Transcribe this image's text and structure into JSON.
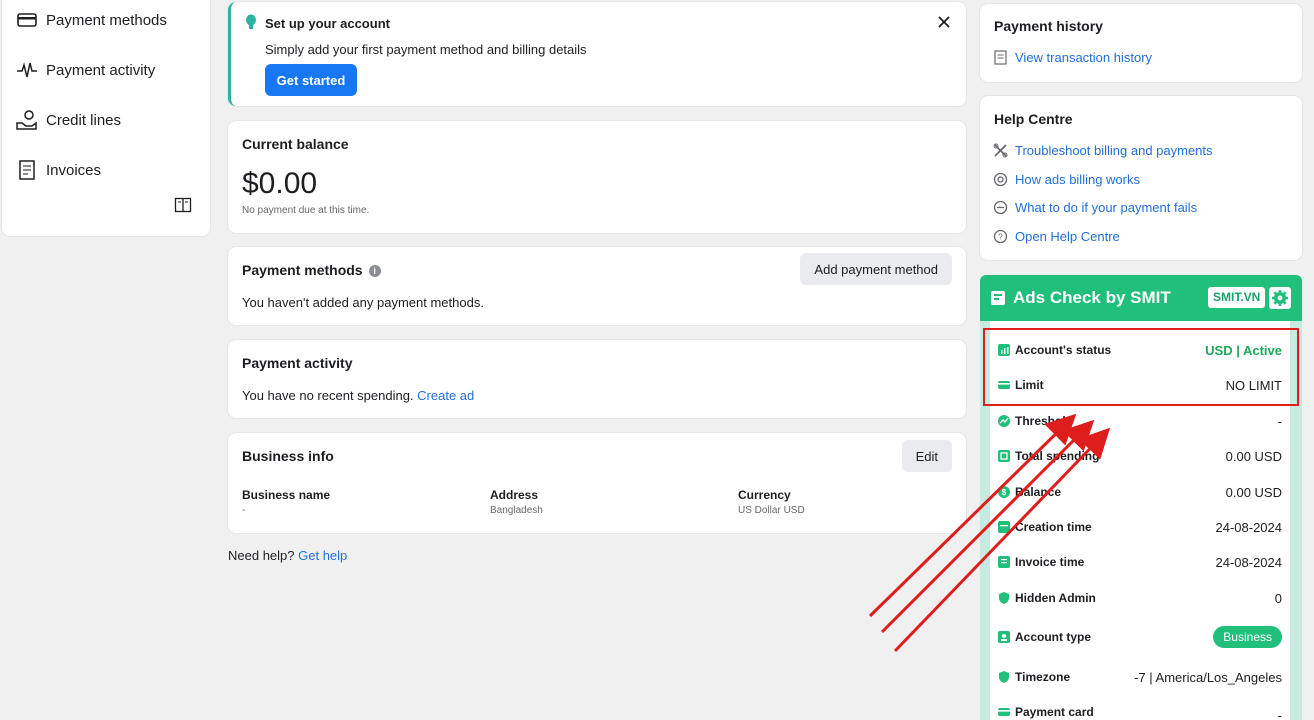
{
  "sidebar": {
    "items": [
      {
        "label": "Payment methods",
        "icon": "card-icon"
      },
      {
        "label": "Payment activity",
        "icon": "activity-icon"
      },
      {
        "label": "Credit lines",
        "icon": "hand-money-icon"
      },
      {
        "label": "Invoices",
        "icon": "invoice-icon"
      }
    ]
  },
  "setup": {
    "title": "Set up your account",
    "description": "Simply add your first payment method and billing details",
    "button": "Get started"
  },
  "balance": {
    "title": "Current balance",
    "amount": "$0.00",
    "note": "No payment due at this time."
  },
  "payment_methods": {
    "title": "Payment methods",
    "button": "Add payment method",
    "text": "You haven't added any payment methods."
  },
  "payment_activity": {
    "title": "Payment activity",
    "text": "You have no recent spending.",
    "link": "Create ad"
  },
  "business_info": {
    "title": "Business info",
    "button": "Edit",
    "columns": [
      {
        "header": "Business name",
        "value": "-"
      },
      {
        "header": "Address",
        "value": "Bangladesh"
      },
      {
        "header": "Currency",
        "value": "US Dollar USD"
      }
    ]
  },
  "need_help": {
    "text": "Need help?",
    "link": "Get help"
  },
  "payment_history": {
    "title": "Payment history",
    "link": "View transaction history"
  },
  "help_centre": {
    "title": "Help Centre",
    "links": [
      "Troubleshoot billing and payments",
      "How ads billing works",
      "What to do if your payment fails",
      "Open Help Centre"
    ]
  },
  "smit": {
    "title": "Ads Check by SMIT",
    "badge": "SMIT.VN",
    "rows": [
      {
        "label": "Account's status",
        "value": "USD | Active"
      },
      {
        "label": "Limit",
        "value": "NO LIMIT"
      },
      {
        "label": "Threshold",
        "value": "-"
      },
      {
        "label": "Total spending",
        "value": "0.00 USD"
      },
      {
        "label": "Balance",
        "value": "0.00 USD"
      },
      {
        "label": "Creation time",
        "value": "24-08-2024"
      },
      {
        "label": "Invoice time",
        "value": "24-08-2024"
      },
      {
        "label": "Hidden Admin",
        "value": "0"
      },
      {
        "label": "Account type",
        "value": "Business"
      },
      {
        "label": "Timezone",
        "value": "-7 | America/Los_Angeles"
      },
      {
        "label": "Payment card",
        "value": "-"
      }
    ]
  },
  "colors": {
    "accent": "#1877f2",
    "smit_green": "#20c07b",
    "highlight": "#e01d1d"
  }
}
